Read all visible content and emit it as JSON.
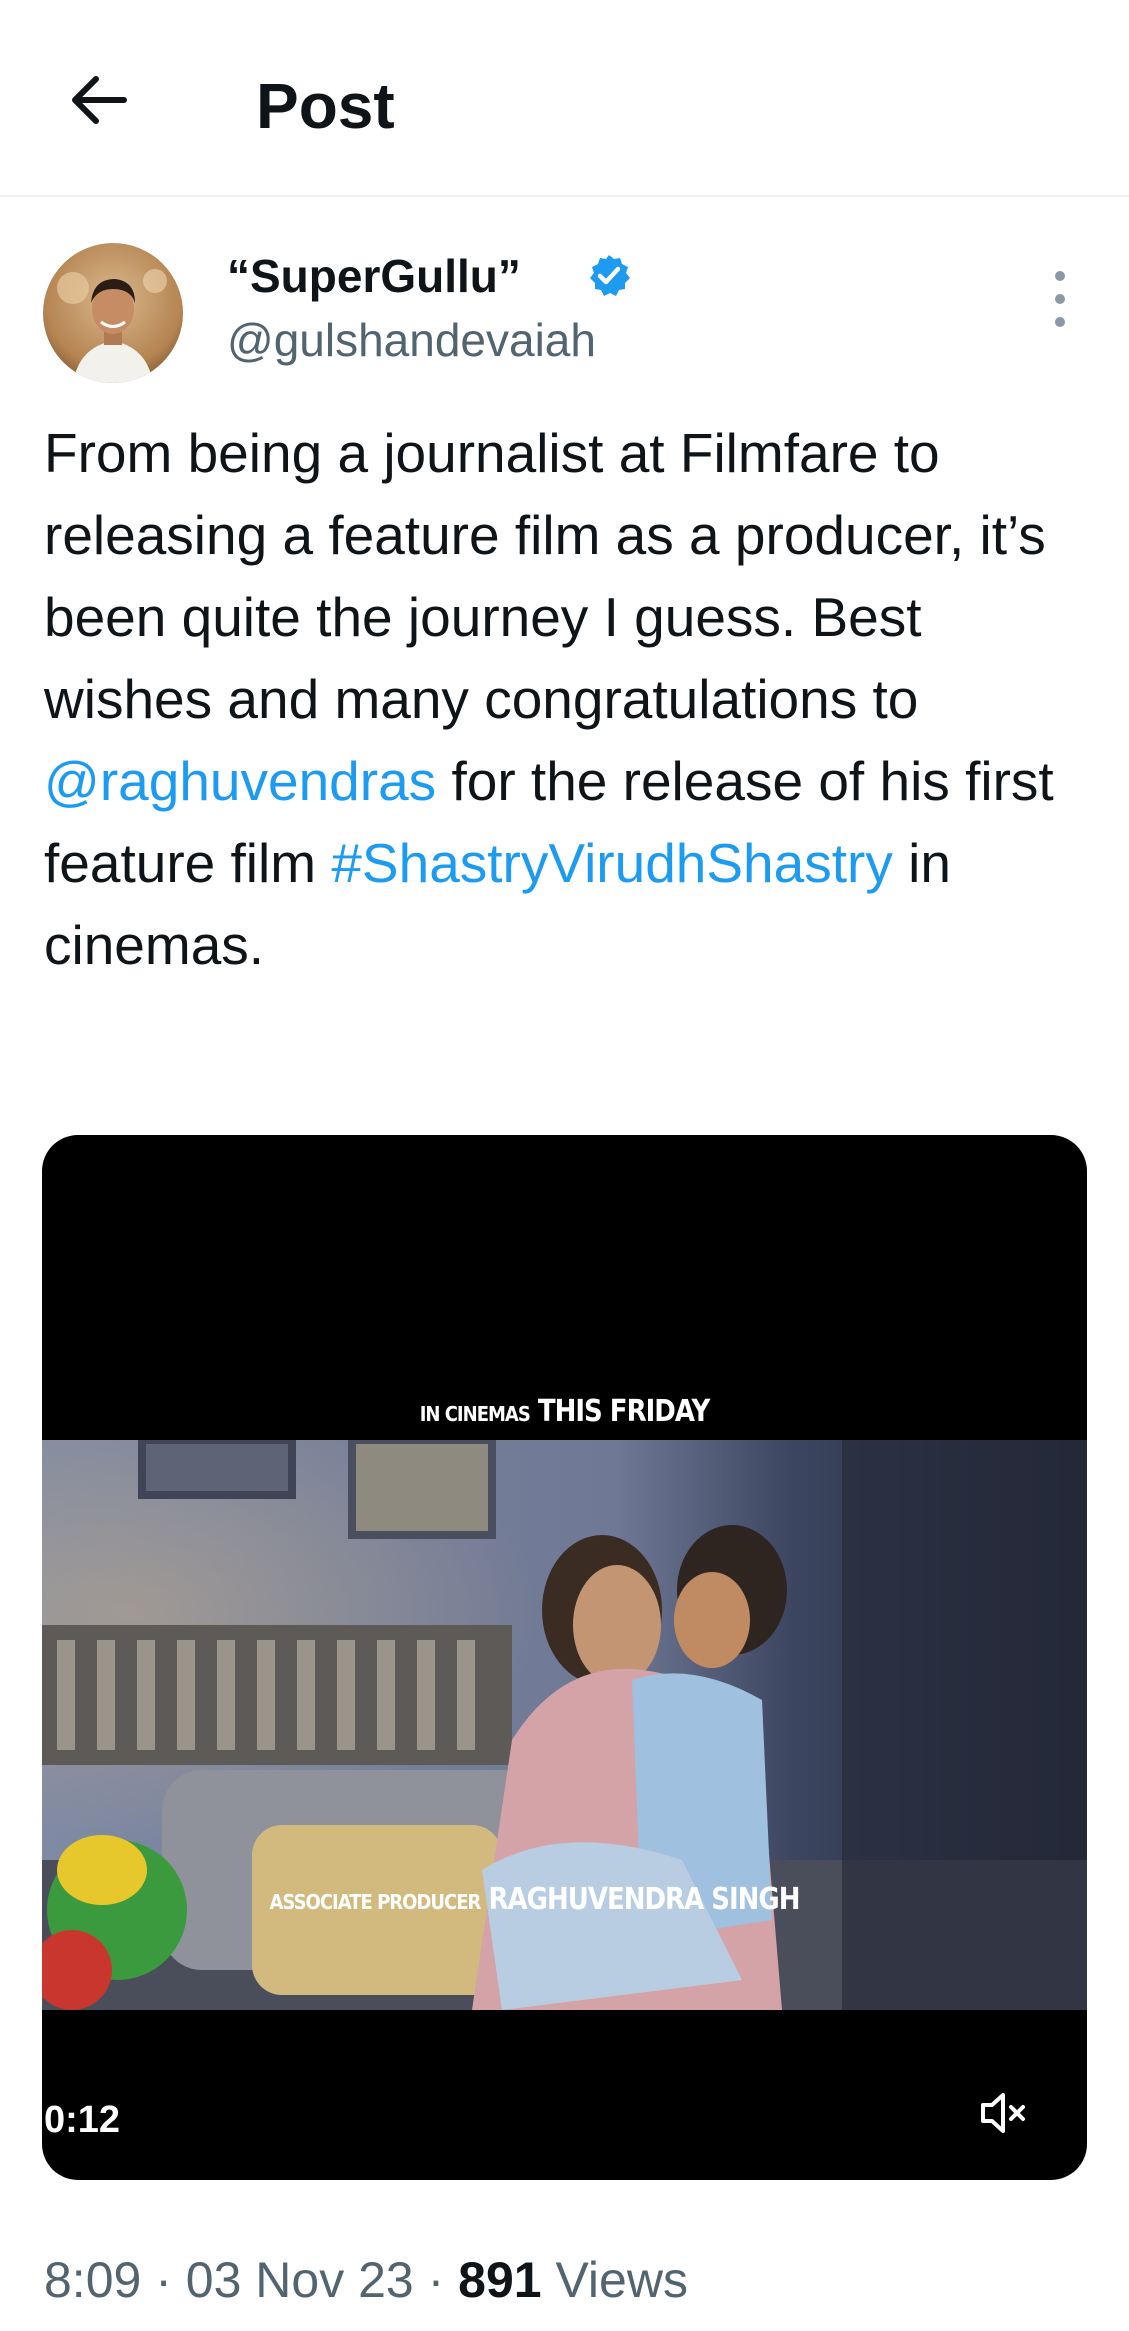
{
  "header": {
    "back_icon": "arrow-left-icon",
    "title": "Post"
  },
  "author": {
    "display_name": "“SuperGullu”",
    "handle": "@gulshandevaiah",
    "verified_icon": "verified-badge-icon",
    "verified_color": "#1d9bf0",
    "more_icon": "more-vertical-icon"
  },
  "tweet": {
    "text_before": "From being a journalist at Filmfare to releasing a feature film as a producer, it’s been quite the journey I guess. Best wishes and many congratulations to ",
    "mention": "@raghuvendras",
    "text_middle": " for the release of his first feature film ",
    "hashtag": "#ShastryVirudhShastry",
    "text_after": " in cinemas.",
    "link_color": "#1d9bf0"
  },
  "video": {
    "caption_top_small": "IN CINEMAS",
    "caption_top_large": "THIS FRIDAY",
    "caption_bottom_small": "ASSOCIATE PRODUCER",
    "caption_bottom_large": "RAGHUVENDRA SINGH",
    "time": "0:12",
    "mute_icon": "speaker-muted-icon"
  },
  "meta": {
    "time": "8:09",
    "separator": " · ",
    "date": "03 Nov 23",
    "views_count": "891",
    "views_label": " Views"
  }
}
